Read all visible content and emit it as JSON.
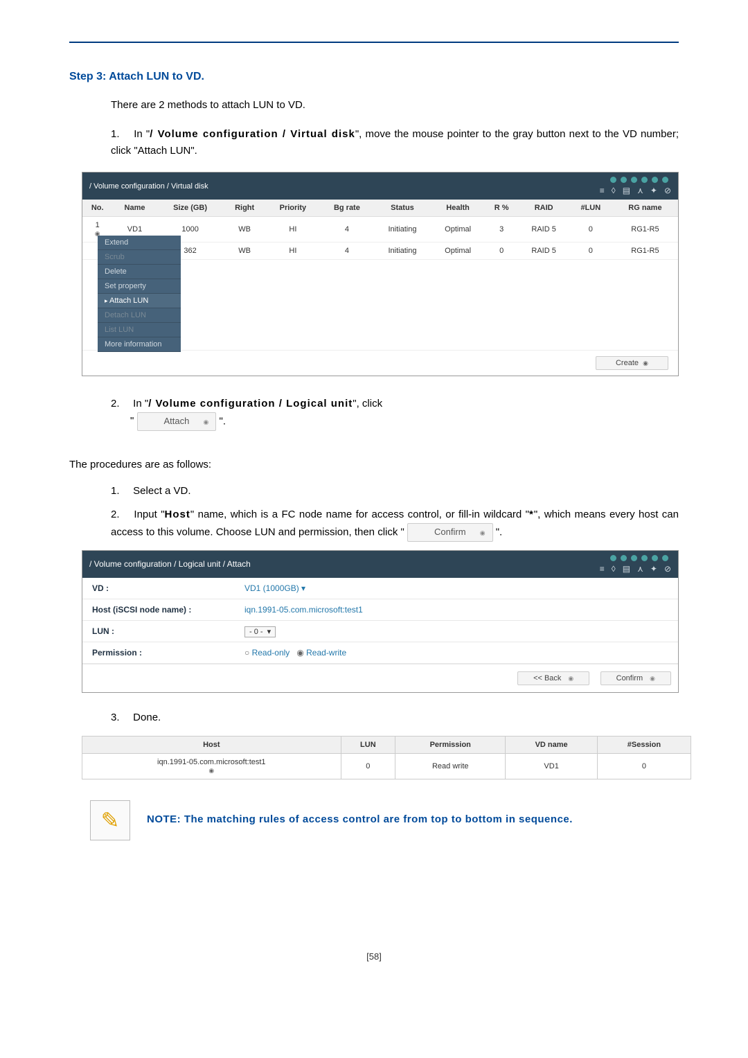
{
  "step_heading": "Step 3: Attach LUN to VD.",
  "intro": "There are 2 methods to attach LUN to VD.",
  "method1_prefix": "1.",
  "method1_a": "In \"",
  "method1_path": "/ Volume configuration / Virtual disk",
  "method1_b": "\", move the mouse pointer to the gray button next to the VD number; click \"Attach LUN\".",
  "shot1": {
    "breadcrumb": "/ Volume configuration / Virtual disk",
    "columns": [
      "No.",
      "Name",
      "Size (GB)",
      "Right",
      "Priority",
      "Bg rate",
      "Status",
      "Health",
      "R %",
      "RAID",
      "#LUN",
      "RG name"
    ],
    "rows": [
      {
        "no": "1",
        "name": "VD1",
        "size": "1000",
        "right": "WB",
        "priority": "HI",
        "bgrate": "4",
        "status": "Initiating",
        "health": "Optimal",
        "r": "3",
        "raid": "RAID 5",
        "lun": "0",
        "rg": "RG1-R5"
      },
      {
        "no": "",
        "name": "",
        "size": "362",
        "right": "WB",
        "priority": "HI",
        "bgrate": "4",
        "status": "Initiating",
        "health": "Optimal",
        "r": "0",
        "raid": "RAID 5",
        "lun": "0",
        "rg": "RG1-R5"
      }
    ],
    "menu": [
      "Extend",
      "Scrub",
      "Delete",
      "Set property",
      "Attach LUN",
      "Detach LUN",
      "List LUN",
      "More information"
    ],
    "create_btn": "Create"
  },
  "method2_prefix": "2.",
  "method2_a": "In \"",
  "method2_path": "/ Volume configuration / Logical unit",
  "method2_b": "\", click",
  "method2_quote_open": "\"",
  "attach_btn_label": "Attach",
  "method2_quote_close": "\".",
  "procedures_heading": "The procedures are as follows:",
  "proc1_prefix": "1.",
  "proc1": "Select a VD.",
  "proc2_prefix": "2.",
  "proc2_a": "Input \"",
  "proc2_host": "Host",
  "proc2_b": "\" name, which is a FC node name for access control, or fill-in wildcard \"",
  "proc2_star": "*",
  "proc2_c": "\", which means every host can access to this volume. Choose LUN and permission, then click \"",
  "confirm_btn_label": "Confirm",
  "proc2_d": "\".",
  "shot2": {
    "breadcrumb": "/ Volume configuration / Logical unit / Attach",
    "vd_label": "VD :",
    "vd_value": "VD1 (1000GB)",
    "host_label": "Host (iSCSI node name) :",
    "host_value": "iqn.1991-05.com.microsoft:test1",
    "lun_label": "LUN :",
    "lun_value": "- 0 -",
    "perm_label": "Permission :",
    "perm_ro": "Read-only",
    "perm_rw": "Read-write",
    "back_btn": "<< Back",
    "confirm_btn": "Confirm"
  },
  "done_prefix": "3.",
  "done": "Done.",
  "result": {
    "columns": [
      "Host",
      "LUN",
      "Permission",
      "VD name",
      "#Session"
    ],
    "row": {
      "host": "iqn.1991-05.com.microsoft:test1",
      "lun": "0",
      "perm": "Read write",
      "vd": "VD1",
      "sess": "0"
    }
  },
  "note": "NOTE: The matching rules of access control are from top to bottom in sequence.",
  "page_number": "[58]"
}
